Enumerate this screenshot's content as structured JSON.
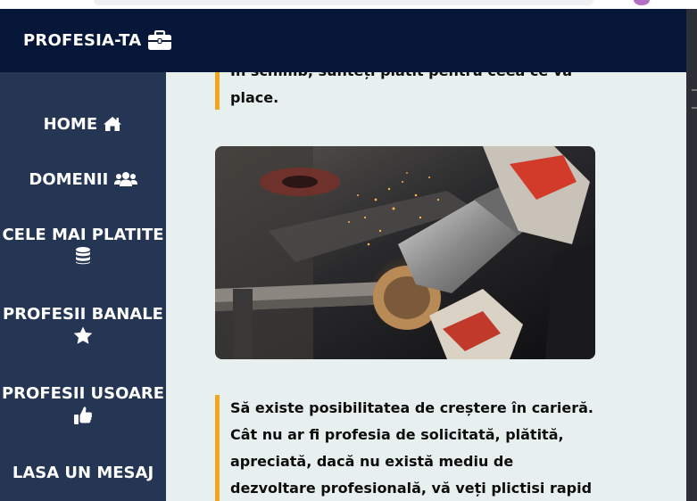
{
  "brand": {
    "name": "PROFESIA-TA",
    "icon": "briefcase-icon"
  },
  "sidebar": {
    "items": [
      {
        "label": "HOME",
        "icon": "home-icon"
      },
      {
        "label": "DOMENII",
        "icon": "users-icon"
      },
      {
        "label": "CELE MAI PLATITE",
        "icon": "database-icon"
      },
      {
        "label": "PROFESII BANALE",
        "icon": "star-icon"
      },
      {
        "label": "PROFESII USOARE",
        "icon": "thumbs-up-icon"
      },
      {
        "label": "LASA UN MESAJ",
        "icon": ""
      }
    ]
  },
  "article": {
    "quote_top": [
      "În schimb, sunteți plătit pentru ceea ce vă",
      "place."
    ],
    "image": {
      "subject": "angle grinder cutting metal with sparks"
    },
    "quote_bottom": [
      "Să existe posibilitatea de creștere în carieră.",
      "Cât nu ar fi profesia de solicitată, plătită,",
      "apreciată, dacă nu există mediu de",
      "dezvoltare profesională, vă veți plictisi rapid"
    ]
  },
  "colors": {
    "topbar": "#061739",
    "sidebar": "#253655",
    "content_bg": "#e8f0ef",
    "accent": "#f2a51f"
  }
}
